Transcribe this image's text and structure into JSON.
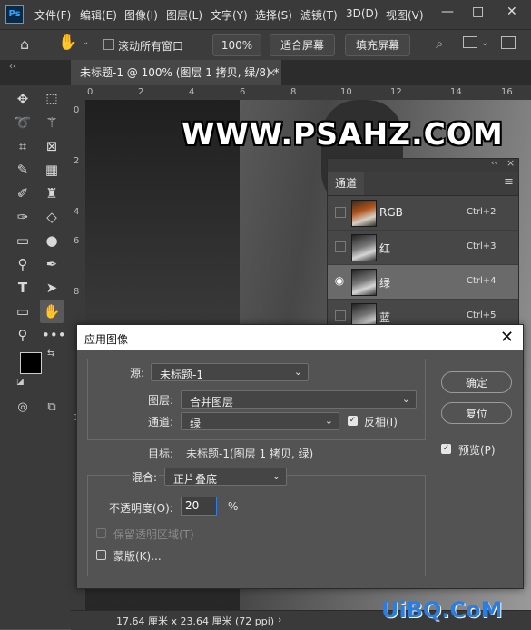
{
  "app": {
    "logo": "Ps"
  },
  "menu": [
    "文件(F)",
    "编辑(E)",
    "图像(I)",
    "图层(L)",
    "文字(Y)",
    "选择(S)",
    "滤镜(T)",
    "3D(D)",
    "视图(V)"
  ],
  "window_controls": {
    "minimize": "—",
    "maximize": "□",
    "close": "✕"
  },
  "options_bar": {
    "scroll_all_label": "滚动所有窗口",
    "zoom_value": "100%",
    "fit_screen": "适合屏幕",
    "fill_screen": "填充屏幕"
  },
  "document_tab": {
    "title": "未标题-1 @ 100% (图层 1 拷贝, 绿/8) *",
    "close": "×"
  },
  "ruler": {
    "h_ticks": [
      "0",
      "2",
      "4",
      "6",
      "8",
      "10",
      "12",
      "14",
      "16"
    ],
    "v_ticks": [
      "0",
      "2",
      "4",
      "6",
      "8",
      "1"
    ]
  },
  "watermark": "WWW.PSAHZ.COM",
  "channels_panel": {
    "collapse": "‹‹",
    "close": "×",
    "tab_label": "通道",
    "menu": "≡",
    "rows": [
      {
        "name": "RGB",
        "shortcut": "Ctrl+2",
        "visible": false,
        "selected": false
      },
      {
        "name": "红",
        "shortcut": "Ctrl+3",
        "visible": false,
        "selected": false
      },
      {
        "name": "绿",
        "shortcut": "Ctrl+4",
        "visible": true,
        "selected": true
      },
      {
        "name": "蓝",
        "shortcut": "Ctrl+5",
        "visible": false,
        "selected": false
      }
    ]
  },
  "dialog": {
    "title": "应用图像",
    "close": "✕",
    "source_label": "源:",
    "source_value": "未标题-1",
    "layer_label": "图层:",
    "layer_value": "合并图层",
    "channel_label": "通道:",
    "channel_value": "绿",
    "invert_label": "反相(I)",
    "invert_checked": true,
    "target_label": "目标:",
    "target_value": "未标题-1(图层 1 拷贝, 绿)",
    "blending_label": "混合:",
    "blending_value": "正片叠底",
    "opacity_label": "不透明度(O):",
    "opacity_value": "20",
    "opacity_unit": "%",
    "preserve_transparency_label": "保留透明区域(T)",
    "mask_label": "蒙版(K)...",
    "ok_button": "确定",
    "reset_button": "复位",
    "preview_label": "预览(P)",
    "preview_checked": true
  },
  "status_bar": {
    "text": "17.64 厘米 x 23.64 厘米 (72 ppi)",
    "arrow": "›"
  },
  "corner_watermark": "UiBQ.CoM"
}
